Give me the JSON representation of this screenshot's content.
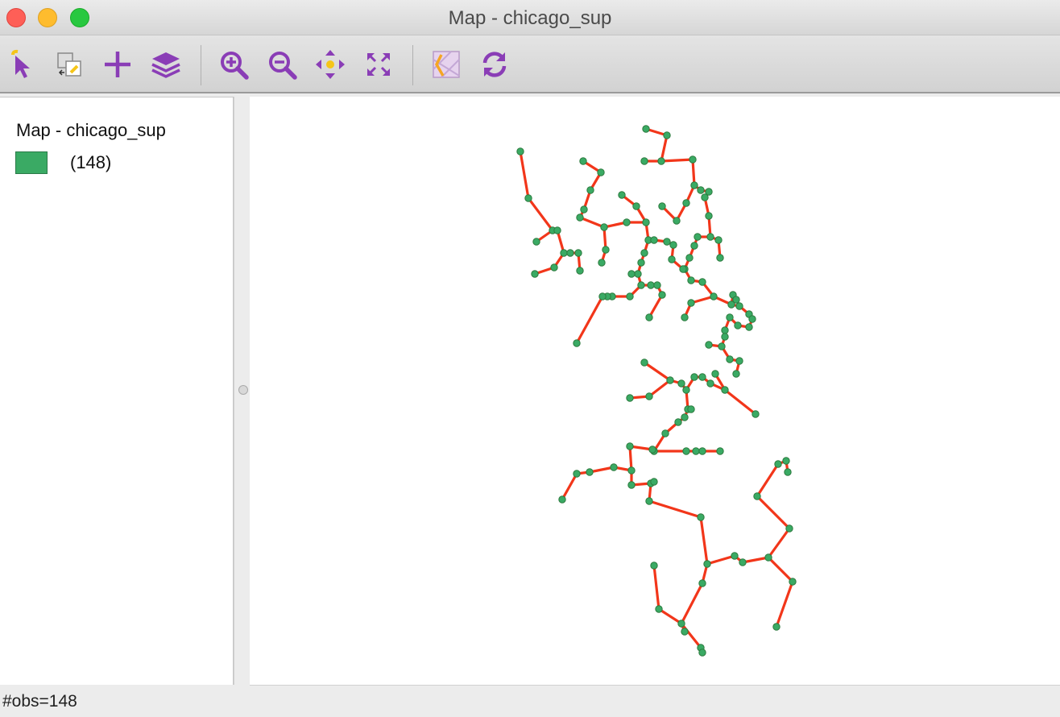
{
  "window": {
    "title": "Map - chicago_sup"
  },
  "toolbar": {
    "tools": [
      {
        "name": "select-tool-button",
        "icon": "select-arrow-icon"
      },
      {
        "name": "selection-mode-button",
        "icon": "selection-shapes-icon"
      },
      {
        "name": "add-layer-button",
        "icon": "plus-icon"
      },
      {
        "name": "layers-button",
        "icon": "layers-icon"
      },
      {
        "name": "zoom-in-button",
        "icon": "zoom-in-icon"
      },
      {
        "name": "zoom-out-button",
        "icon": "zoom-out-icon"
      },
      {
        "name": "pan-button",
        "icon": "pan-icon"
      },
      {
        "name": "fit-to-window-button",
        "icon": "fit-extent-icon"
      },
      {
        "name": "basemap-button",
        "icon": "basemap-icon"
      },
      {
        "name": "refresh-button",
        "icon": "refresh-icon"
      }
    ],
    "icon_color": "#8a3db6",
    "accent_color": "#f5c518"
  },
  "legend": {
    "title": "Map - chicago_sup",
    "items": [
      {
        "count_label": "(148)",
        "color": "#3aaa64"
      }
    ]
  },
  "map": {
    "edge_color": "#f2361a",
    "point_color": "#3aaa64"
  },
  "status": {
    "text": "#obs=148"
  }
}
